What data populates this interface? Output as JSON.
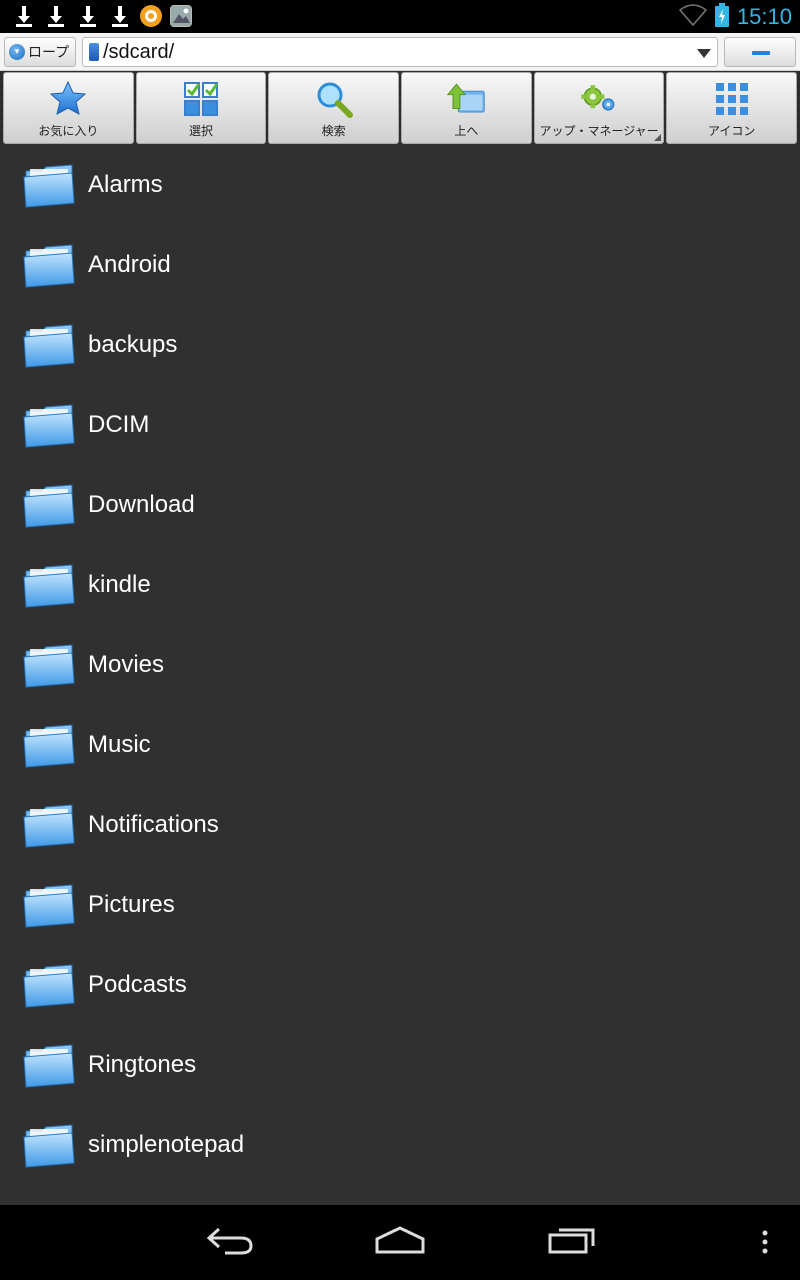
{
  "status_bar": {
    "time": "15:10",
    "notification_icons": [
      "download-icon",
      "download-icon",
      "download-icon",
      "download-icon",
      "app-notification-icon",
      "gallery-notification-icon"
    ],
    "wifi_icon": "wifi-icon",
    "battery_icon": "battery-charging-icon"
  },
  "path_bar": {
    "storage_label": "ロープ",
    "path": "/sdcard/"
  },
  "toolbar": {
    "items": [
      {
        "label": "お気に入り",
        "icon": "star-icon"
      },
      {
        "label": "選択",
        "icon": "select-icon"
      },
      {
        "label": "検索",
        "icon": "search-icon"
      },
      {
        "label": "上へ",
        "icon": "up-folder-icon"
      },
      {
        "label": "アップ・マネージャー",
        "icon": "gears-icon"
      },
      {
        "label": "アイコン",
        "icon": "grid-icon"
      }
    ]
  },
  "files": [
    {
      "name": "Alarms"
    },
    {
      "name": "Android"
    },
    {
      "name": "backups"
    },
    {
      "name": "DCIM"
    },
    {
      "name": "Download"
    },
    {
      "name": "kindle"
    },
    {
      "name": "Movies"
    },
    {
      "name": "Music"
    },
    {
      "name": "Notifications"
    },
    {
      "name": "Pictures"
    },
    {
      "name": "Podcasts"
    },
    {
      "name": "Ringtones"
    },
    {
      "name": "simplenotepad"
    }
  ],
  "colors": {
    "accent": "#33b5e5",
    "list_background": "#303030",
    "folder_blue": "#5fb4f0"
  }
}
